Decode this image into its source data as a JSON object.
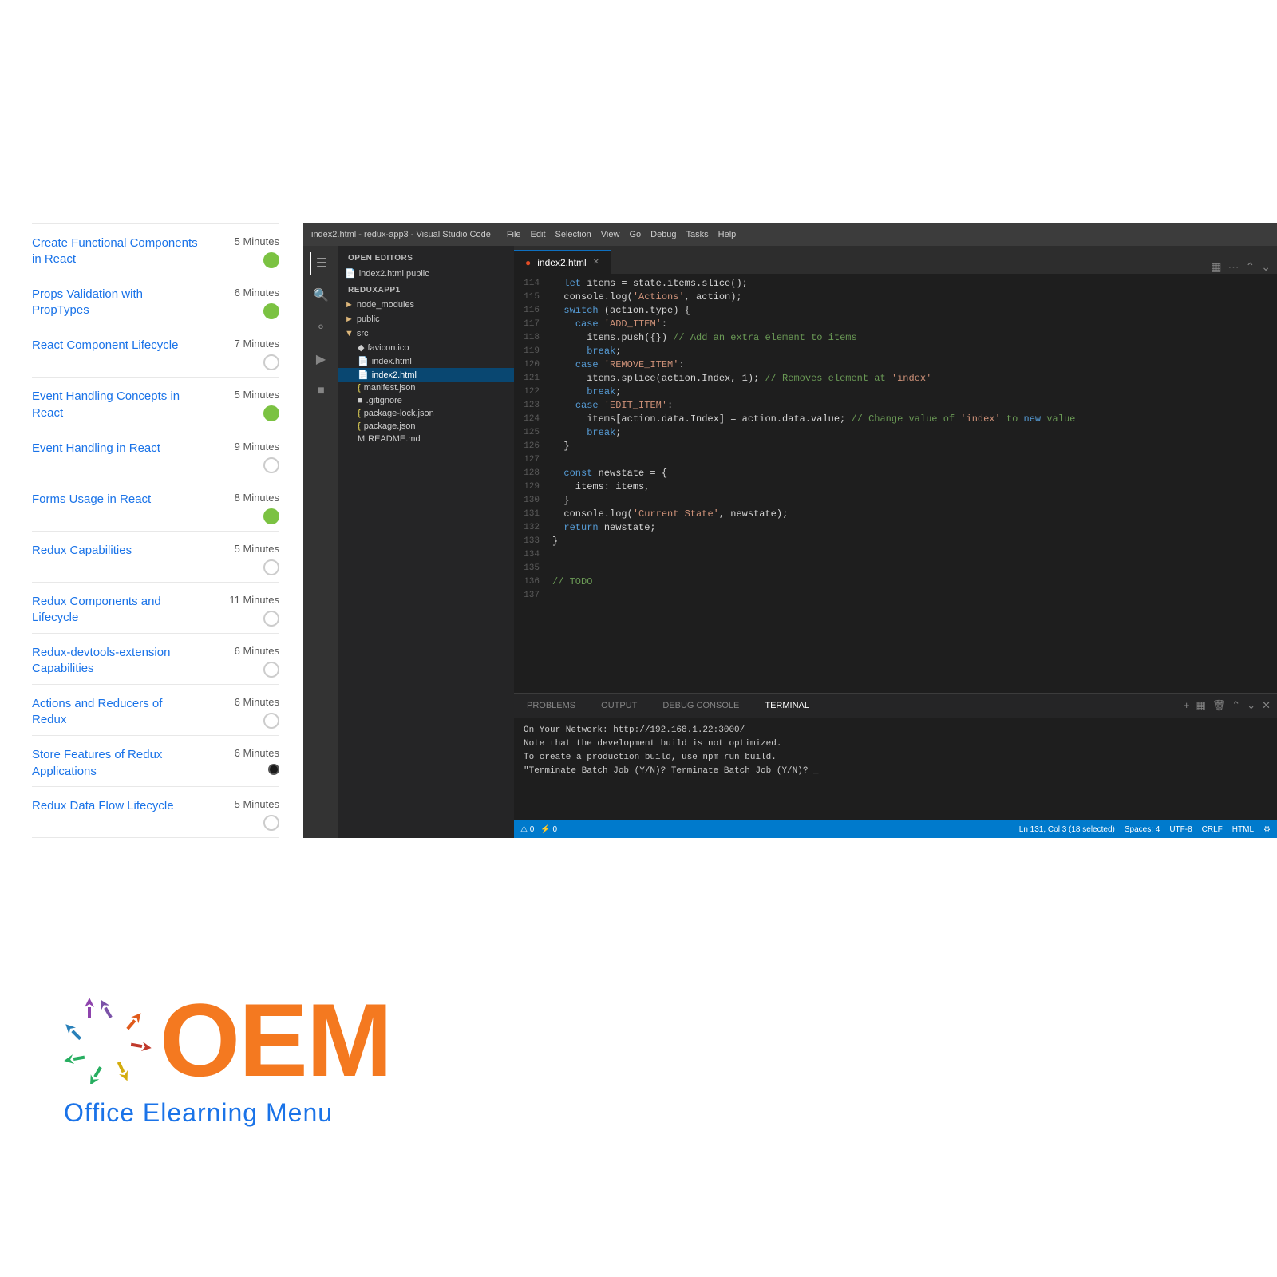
{
  "sidebar": {
    "lessons": [
      {
        "title": "Create Functional Components in React",
        "minutes": "5 Minutes",
        "status": "green"
      },
      {
        "title": "Props Validation with PropTypes",
        "minutes": "6 Minutes",
        "status": "green"
      },
      {
        "title": "React Component Lifecycle",
        "minutes": "7 Minutes",
        "status": "empty"
      },
      {
        "title": "Event Handling Concepts in React",
        "minutes": "5 Minutes",
        "status": "green"
      },
      {
        "title": "Event Handling in React",
        "minutes": "9 Minutes",
        "status": "empty"
      },
      {
        "title": "Forms Usage in React",
        "minutes": "8 Minutes",
        "status": "green"
      },
      {
        "title": "Redux Capabilities",
        "minutes": "5 Minutes",
        "status": "empty"
      },
      {
        "title": "Redux Components and Lifecycle",
        "minutes": "11 Minutes",
        "status": "empty"
      },
      {
        "title": "Redux-devtools-extension Capabilities",
        "minutes": "6 Minutes",
        "status": "empty"
      },
      {
        "title": "Actions and Reducers of Redux",
        "minutes": "6 Minutes",
        "status": "empty"
      },
      {
        "title": "Store Features of Redux Applications",
        "minutes": "6 Minutes",
        "status": "green",
        "active": true
      },
      {
        "title": "Redux Data Flow Lifecycle",
        "minutes": "5 Minutes",
        "status": "empty"
      }
    ]
  },
  "vscode": {
    "titlebar": "index2.html - redux-app3 - Visual Studio Code",
    "menu_items": [
      "File",
      "Edit",
      "Selection",
      "View",
      "Go",
      "Debug",
      "Tasks",
      "Help"
    ],
    "tabs": [
      "index2.html"
    ],
    "explorer": {
      "open_editors_label": "OPEN EDITORS",
      "open_files": [
        "index2.html public"
      ],
      "reduxapp_label": "REDUXAPP1",
      "folders": {
        "node_modules": "node_modules",
        "public": "public",
        "src": "src",
        "src_files": [
          "favicon.ico",
          "index.html",
          "index2.html",
          "manifest.json"
        ],
        "root_files": [
          ".gitignore",
          "package-lock.json",
          "package.json",
          "README.md"
        ]
      }
    },
    "code_lines": [
      {
        "num": "114",
        "content": "  let items = state.items.slice();"
      },
      {
        "num": "115",
        "content": "  console.log('Actions', action);"
      },
      {
        "num": "116",
        "content": "  switch (action.type) {"
      },
      {
        "num": "117",
        "content": "    case 'ADD_ITEM':"
      },
      {
        "num": "118",
        "content": "      items.push({}) // Add an extra element to items"
      },
      {
        "num": "119",
        "content": "      break;"
      },
      {
        "num": "120",
        "content": "    case 'REMOVE_ITEM':"
      },
      {
        "num": "121",
        "content": "      items.splice(action.Index, 1); // Removes element at 'index'"
      },
      {
        "num": "122",
        "content": "      break;"
      },
      {
        "num": "123",
        "content": "    case 'EDIT_ITEM':"
      },
      {
        "num": "124",
        "content": "      items[action.data.Index] = action.data.value; // Change value of 'index' to new value"
      },
      {
        "num": "125",
        "content": "      break;"
      },
      {
        "num": "126",
        "content": "  }"
      },
      {
        "num": "127",
        "content": ""
      },
      {
        "num": "128",
        "content": "  const newstate = {"
      },
      {
        "num": "129",
        "content": "    items: items,"
      },
      {
        "num": "130",
        "content": "  }"
      },
      {
        "num": "131",
        "content": "  console.log('Current State', newstate);"
      },
      {
        "num": "132",
        "content": "  return newstate;"
      },
      {
        "num": "133",
        "content": "}"
      },
      {
        "num": "134",
        "content": ""
      },
      {
        "num": "135",
        "content": ""
      },
      {
        "num": "136",
        "content": "// TODO"
      },
      {
        "num": "137",
        "content": ""
      }
    ],
    "panel_tabs": [
      "PROBLEMS",
      "OUTPUT",
      "DEBUG CONSOLE",
      "TERMINAL"
    ],
    "terminal_lines": [
      "On Your Network:  http://192.168.1.22:3000/",
      "",
      "Note that the development build is not optimized.",
      "To create a production build, use npm run build.",
      "",
      "\"Terminate Batch Job (Y/N)? Terminate Batch Job (Y/N)? _"
    ],
    "statusbar": {
      "left": [
        "⚠ 0",
        "⚡ 0"
      ],
      "right": [
        "Ln 131, Col 3 (18 selected)",
        "Spaces: 4",
        "UTF-8",
        "CRLF",
        "HTML",
        "⚡"
      ]
    }
  },
  "logo": {
    "text": "OEM",
    "subtitle": "Office Elearning Menu"
  }
}
